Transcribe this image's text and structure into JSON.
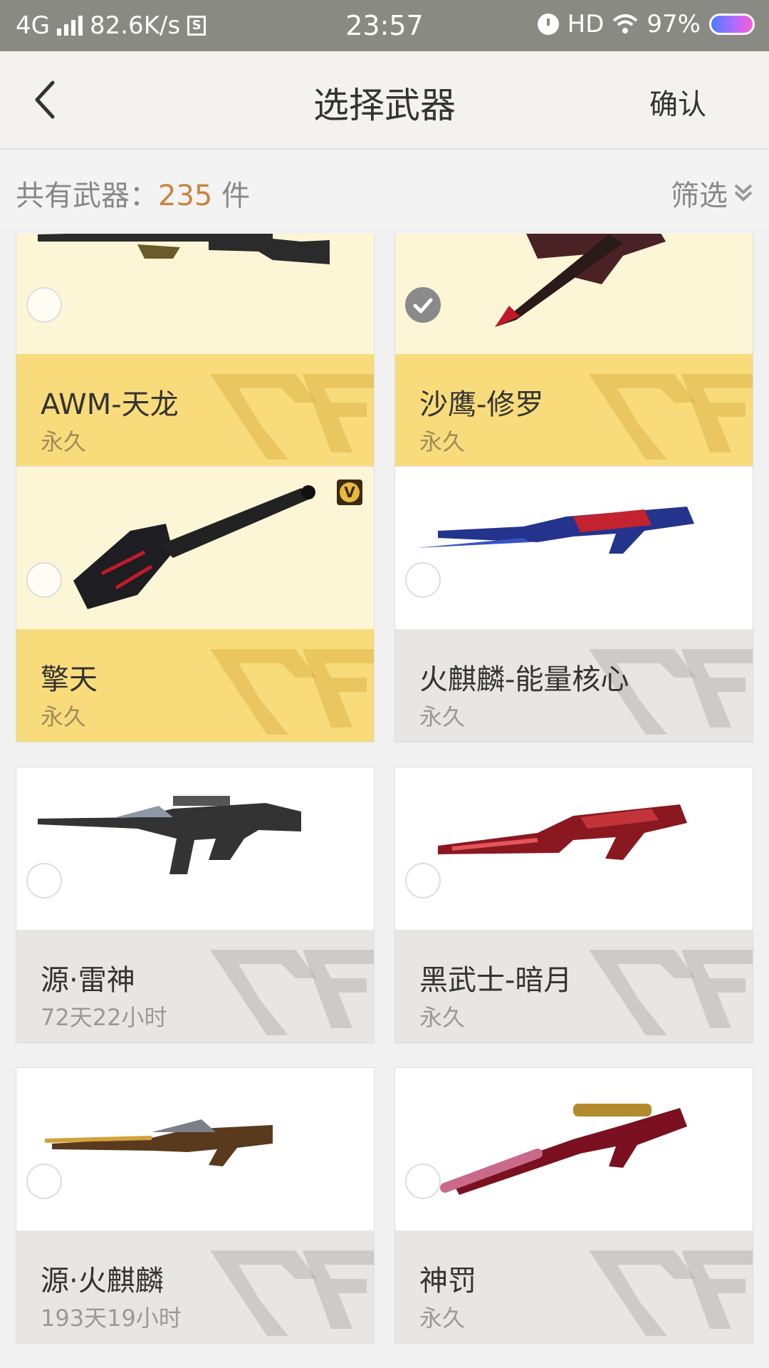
{
  "status_bar": {
    "network": "4G",
    "speed": "82.6K/s",
    "sim_badge": "S",
    "time": "23:57",
    "hd": "HD",
    "battery": "97%"
  },
  "header": {
    "title": "选择武器",
    "confirm_label": "确认"
  },
  "summary": {
    "prefix": "共有武器：",
    "count": "235",
    "suffix": " 件",
    "filter_label": "筛选"
  },
  "weapons": [
    {
      "name": "AWM-天龙",
      "duration": "永久",
      "style": "gold",
      "selected": false,
      "vip": true
    },
    {
      "name": "沙鹰-修罗",
      "duration": "永久",
      "style": "gold",
      "selected": true,
      "vip": true
    },
    {
      "name": "擎天",
      "duration": "永久",
      "style": "gold",
      "selected": false,
      "vip": true
    },
    {
      "name": "火麒麟-能量核心",
      "duration": "永久",
      "style": "grey",
      "selected": false,
      "vip": false
    },
    {
      "name": "源·雷神",
      "duration": "72天22小时",
      "style": "grey",
      "selected": false,
      "vip": false
    },
    {
      "name": "黑武士-暗月",
      "duration": "永久",
      "style": "grey",
      "selected": false,
      "vip": false
    },
    {
      "name": "源·火麒麟",
      "duration": "193天19小时",
      "style": "grey",
      "selected": false,
      "vip": false
    },
    {
      "name": "神罚",
      "duration": "永久",
      "style": "grey",
      "selected": false,
      "vip": false
    }
  ],
  "colors": {
    "accent_count": "#c8843f",
    "gold_top": "#fdf6d6",
    "gold_bottom": "#f8dc7c",
    "grey_bottom": "#e8e6e4"
  }
}
